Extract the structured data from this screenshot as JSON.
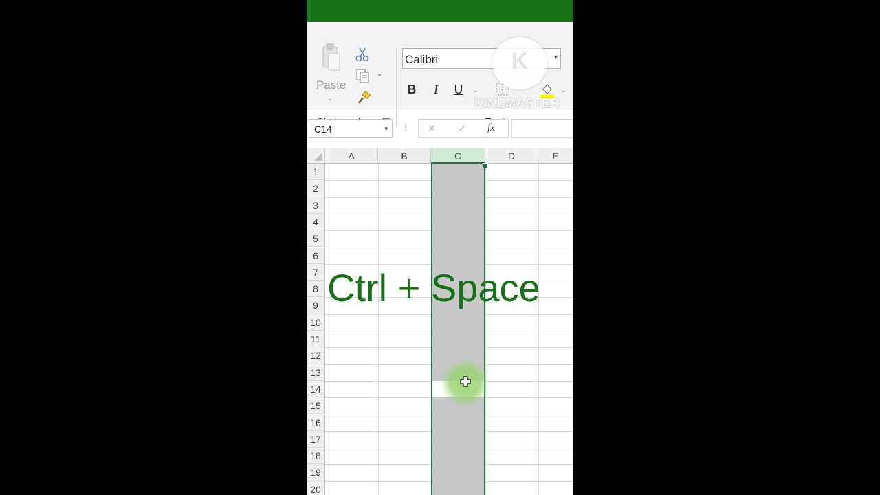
{
  "ribbon": {
    "clipboard": {
      "paste_label": "Paste",
      "group_label": "Clipboard",
      "paste_dropdown_glyph": "⌄",
      "copy_dropdown_glyph": "⌄"
    },
    "font": {
      "font_name": "Calibri",
      "font_dropdown_glyph": "▾",
      "bold_label": "B",
      "italic_label": "I",
      "underline_label": "U",
      "underline_dropdown_glyph": "⌄",
      "fill_dropdown_glyph": "⌄",
      "group_label": "Font"
    },
    "icons": [
      "paste-icon",
      "cut-icon",
      "copy-icon",
      "format-painter-icon",
      "dialog-launcher-icon",
      "borders-icon",
      "fill-color-icon"
    ]
  },
  "watermark": {
    "logo_letter": "K",
    "text": "KINEMASTER"
  },
  "formula_bar": {
    "name_box": "C14",
    "dropdown_glyph": "▾",
    "separator_glyph": "⁝",
    "cancel_glyph": "✕",
    "enter_glyph": "✓",
    "fx_label": "fx",
    "value": ""
  },
  "sheet": {
    "columns": [
      "A",
      "B",
      "C",
      "D",
      "E"
    ],
    "rows": [
      "1",
      "2",
      "3",
      "4",
      "5",
      "6",
      "7",
      "8",
      "9",
      "10",
      "11",
      "12",
      "13",
      "14",
      "15",
      "16",
      "17",
      "18",
      "19",
      "20"
    ],
    "selected_column": "C",
    "active_cell": "C14"
  },
  "overlay": {
    "text": "Ctrl + Space",
    "color": "#1a6f1a"
  },
  "colors": {
    "title_bar": "#187115",
    "excel_green": "#217346",
    "selection_fill": "#c8c8c8",
    "cursor_highlight": "#96d26e"
  }
}
